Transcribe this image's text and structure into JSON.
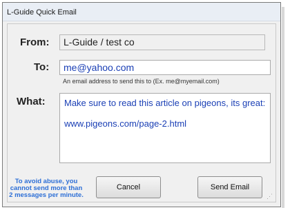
{
  "window": {
    "title": "L-Guide Quick Email"
  },
  "form": {
    "from_label": "From:",
    "from_value": "L-Guide / test co",
    "to_label": "To:",
    "to_value": "me@yahoo.com",
    "to_hint": "An email address to send this to (Ex. me@myemail.com)",
    "what_label": "What:",
    "message_line1": "Make sure to read this article on pigeons, its great:",
    "message_line2": "www.pigeons.com/page-2.html"
  },
  "footer": {
    "abuse_note": "To avoid abuse, you cannot send more than 2 messages per minute.",
    "cancel_label": "Cancel",
    "send_label": "Send Email"
  },
  "colors": {
    "input_text": "#1a3fb5",
    "note_text": "#2d6fd6"
  },
  "icons": {
    "resize_grip": "resize-grip-icon"
  }
}
